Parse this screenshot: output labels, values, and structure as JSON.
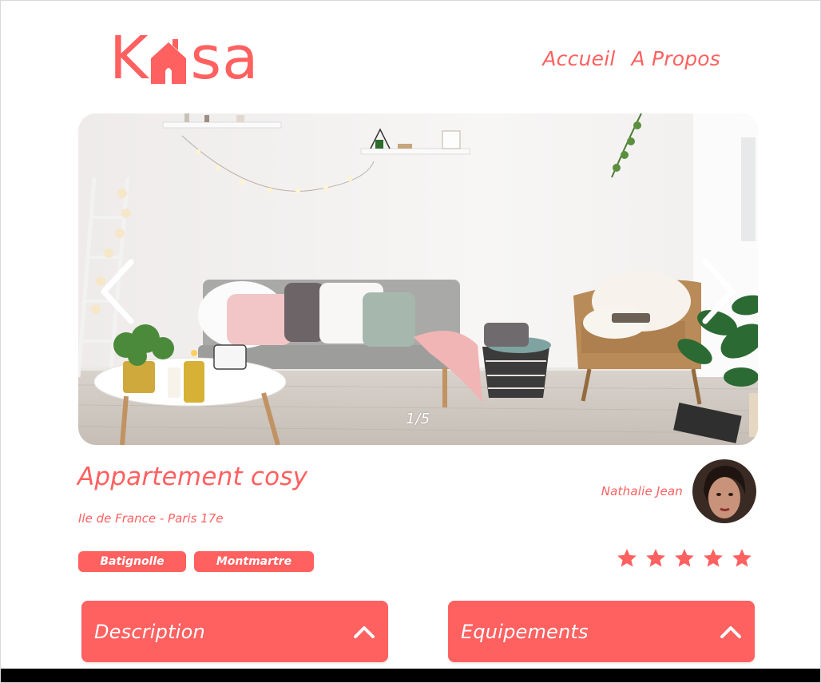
{
  "brand": {
    "logo_left": "K",
    "logo_right": "sa",
    "accent_color": "#FF6060"
  },
  "nav": {
    "items": [
      {
        "label": "Accueil"
      },
      {
        "label": "A Propos"
      }
    ]
  },
  "carousel": {
    "counter": "1/5",
    "prev_icon": "chevron-left-icon",
    "next_icon": "chevron-right-icon"
  },
  "listing": {
    "title": "Appartement cosy",
    "location": "Ile de France - Paris 17e",
    "tags": [
      {
        "label": "Batignolle"
      },
      {
        "label": "Montmartre"
      }
    ],
    "rating": {
      "value": 5,
      "max": 5
    }
  },
  "host": {
    "name": "Nathalie Jean"
  },
  "collapses": [
    {
      "label": "Description",
      "icon": "chevron-up-icon"
    },
    {
      "label": "Equipements",
      "icon": "chevron-up-icon"
    }
  ]
}
